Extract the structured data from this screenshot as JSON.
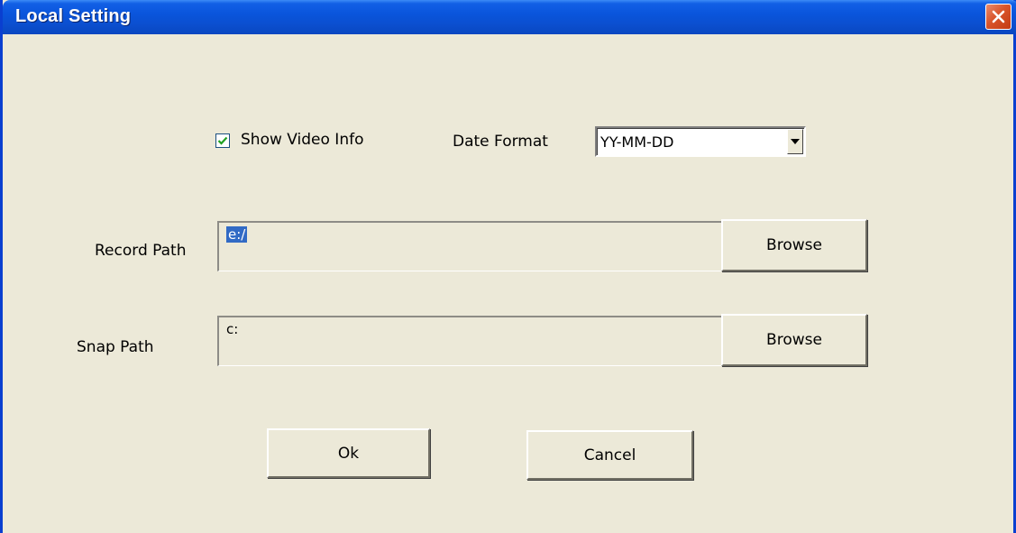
{
  "window": {
    "title": "Local Setting"
  },
  "titlebar": {
    "close_icon": "close-icon"
  },
  "video_info": {
    "label": "Show Video Info",
    "checked": true
  },
  "date_format": {
    "label": "Date Format",
    "value": "YY-MM-DD"
  },
  "record_path": {
    "label": "Record Path",
    "value": "e:/",
    "browse_label": "Browse"
  },
  "snap_path": {
    "label": "Snap Path",
    "value": "c:",
    "browse_label": "Browse"
  },
  "footer": {
    "ok_label": "Ok",
    "cancel_label": "Cancel"
  }
}
